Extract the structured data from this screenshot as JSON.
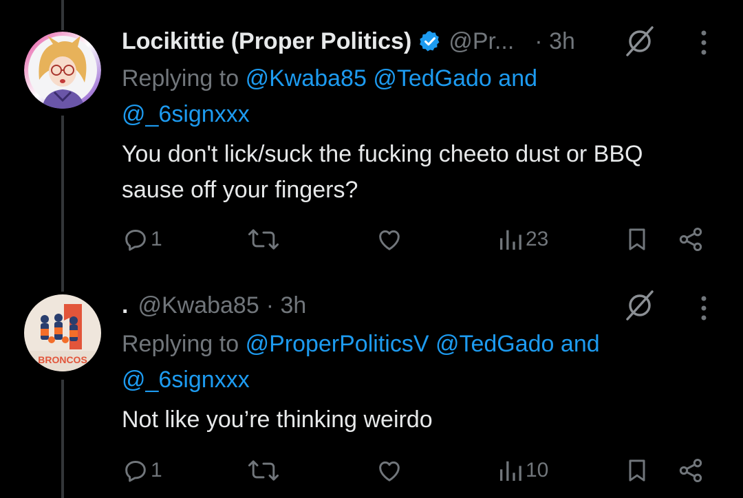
{
  "tweets": [
    {
      "display_name": "Locikittie (Proper Politics)",
      "handle": "@Pr...",
      "time": "· 3h",
      "replying_label": "Replying to",
      "mention_1": "@Kwaba85",
      "mention_2": "@TedGado",
      "and_label": "and",
      "mention_3": "@_6signxxx",
      "text_line_1": "You don't lick/suck the fucking cheeto dust or BBQ",
      "text_line_2": "sause off your fingers?",
      "reply_count": "1",
      "views": "23",
      "verified": true
    },
    {
      "display_name": ".",
      "handle": "@Kwaba85",
      "time": "· 3h",
      "replying_label": "Replying to",
      "mention_1": "@ProperPoliticsV",
      "mention_2": "@TedGado",
      "and_label": "and",
      "mention_3": "@_6signxxx",
      "text_line_1": "Not like you’re thinking weirdo",
      "reply_count": "1",
      "views": "10",
      "verified": false
    }
  ],
  "colors": {
    "background": "#000000",
    "text": "#e7e9ea",
    "muted": "#71767b",
    "link": "#1d9bf0",
    "thread_line": "#333639"
  },
  "icons": [
    "verified-badge-icon",
    "grok-icon",
    "more-icon",
    "reply-icon",
    "retweet-icon",
    "like-icon",
    "views-icon",
    "bookmark-icon",
    "share-icon"
  ]
}
